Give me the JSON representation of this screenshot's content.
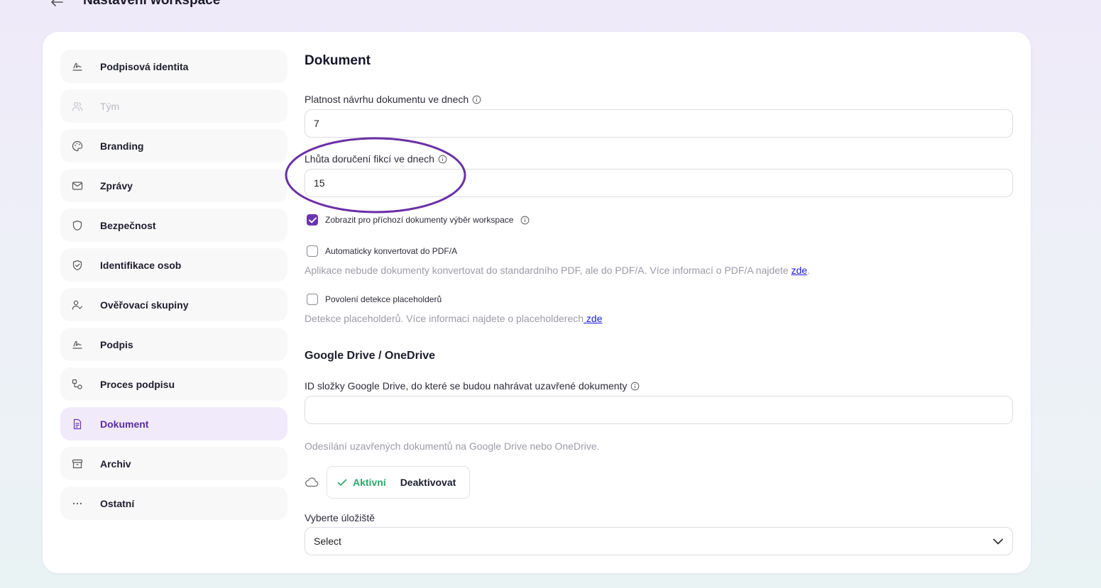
{
  "header": {
    "title": "Nastavení workspace",
    "back_icon": "arrow-left-icon"
  },
  "sidebar": {
    "items": [
      {
        "label": "Podpisová identita",
        "icon": "signature-icon",
        "state": "normal"
      },
      {
        "label": "Tým",
        "icon": "users-icon",
        "state": "disabled"
      },
      {
        "label": "Branding",
        "icon": "palette-icon",
        "state": "normal"
      },
      {
        "label": "Zprávy",
        "icon": "mail-icon",
        "state": "normal"
      },
      {
        "label": "Bezpečnost",
        "icon": "shield-icon",
        "state": "normal"
      },
      {
        "label": "Identifikace osob",
        "icon": "shield-check-icon",
        "state": "normal"
      },
      {
        "label": "Ověřovací skupiny",
        "icon": "user-check-icon",
        "state": "normal"
      },
      {
        "label": "Podpis",
        "icon": "signature-icon",
        "state": "normal"
      },
      {
        "label": "Proces podpisu",
        "icon": "workflow-icon",
        "state": "normal"
      },
      {
        "label": "Dokument",
        "icon": "document-icon",
        "state": "active"
      },
      {
        "label": "Archiv",
        "icon": "archive-icon",
        "state": "normal"
      },
      {
        "label": "Ostatní",
        "icon": "more-icon",
        "state": "normal"
      }
    ]
  },
  "main": {
    "title": "Dokument",
    "validity": {
      "label": "Platnost návrhu dokumentu ve dnech",
      "value": "7"
    },
    "delivery": {
      "label": "Lhůta doručení fikcí ve dnech",
      "value": "15"
    },
    "show_workspace_select": {
      "label": "Zobrazit pro příchozí dokumenty výběr workspace",
      "checked": true
    },
    "auto_pdfa": {
      "label": "Automaticky konvertovat do PDF/A",
      "checked": false,
      "help": "Aplikace nebude dokumenty konvertovat do standardního PDF, ale do PDF/A. Více informací o PDF/A najdete ",
      "link": "zde",
      "suffix": "."
    },
    "placeholder_detection": {
      "label": "Povolení detekce placeholderů",
      "checked": false,
      "help": "Detekce placeholderů. Více informací najdete o placeholderech",
      "link": " zde"
    },
    "cloud": {
      "title": "Google Drive / OneDrive",
      "folder_label": "ID složky Google Drive, do které se budou nahrávat uzavřené dokumenty",
      "folder_value": "",
      "help": "Odesílání uzavřených dokumentů na Google Drive nebo OneDrive.",
      "active_label": "Aktivní",
      "deactivate_label": "Deaktivovat",
      "storage_label": "Vyberte úložiště",
      "storage_value": "Select"
    }
  },
  "colors": {
    "accent": "#6b35b0",
    "active_bg": "#f1eafb",
    "success": "#2aa86a",
    "link": "#1a1adb",
    "annotation": "#6b2fa5"
  }
}
